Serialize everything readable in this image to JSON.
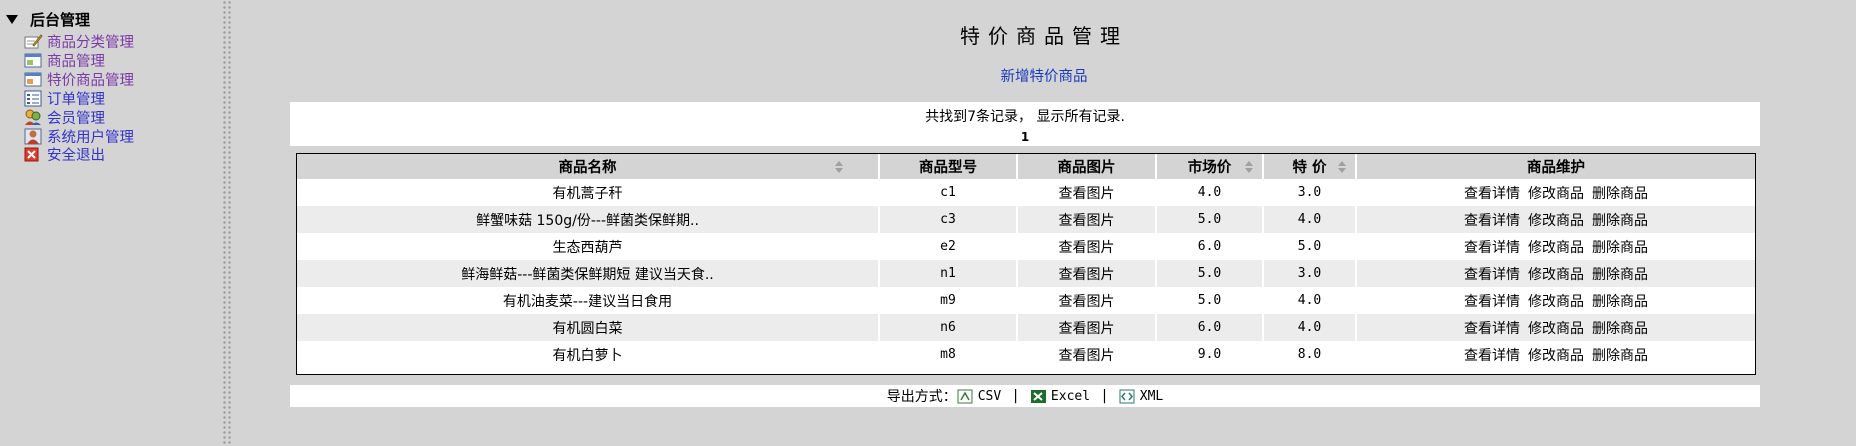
{
  "sidebar": {
    "root_label": "后台管理",
    "items": [
      {
        "label": "商品分类管理",
        "icon": "pencil-note-icon"
      },
      {
        "label": "商品管理",
        "icon": "window-icon"
      },
      {
        "label": "特价商品管理",
        "icon": "window-icon"
      },
      {
        "label": "订单管理",
        "icon": "list-icon"
      },
      {
        "label": "会员管理",
        "icon": "users-icon"
      },
      {
        "label": "系统用户管理",
        "icon": "user-icon"
      },
      {
        "label": "安全退出",
        "icon": "close-icon"
      }
    ]
  },
  "main": {
    "title": "特价商品管理",
    "add_link": "新增特价商品",
    "summary": "共找到7条记录， 显示所有记录.",
    "page_number": "1"
  },
  "table": {
    "headers": [
      "商品名称",
      "商品型号",
      "商品图片",
      "市场价",
      "特 价",
      "商品维护"
    ],
    "rows": [
      {
        "name": "有机蒿子秆",
        "model": "c1",
        "image": "查看图片",
        "market_price": "4.0",
        "special_price": "3.0"
      },
      {
        "name": "鲜蟹味菇 150g/份---鲜菌类保鲜期..",
        "model": "c3",
        "image": "查看图片",
        "market_price": "5.0",
        "special_price": "4.0"
      },
      {
        "name": "生态西葫芦",
        "model": "e2",
        "image": "查看图片",
        "market_price": "6.0",
        "special_price": "5.0"
      },
      {
        "name": "鲜海鲜菇---鲜菌类保鲜期短 建议当天食..",
        "model": "n1",
        "image": "查看图片",
        "market_price": "5.0",
        "special_price": "3.0"
      },
      {
        "name": "有机油麦菜---建议当日食用",
        "model": "m9",
        "image": "查看图片",
        "market_price": "5.0",
        "special_price": "4.0"
      },
      {
        "name": "有机圆白菜",
        "model": "n6",
        "image": "查看图片",
        "market_price": "6.0",
        "special_price": "4.0"
      },
      {
        "name": "有机白萝卜",
        "model": "m8",
        "image": "查看图片",
        "market_price": "9.0",
        "special_price": "8.0"
      }
    ],
    "actions": [
      "查看详情",
      "修改商品",
      "删除商品"
    ]
  },
  "export": {
    "label": "导出方式：",
    "csv": "CSV",
    "excel": "Excel",
    "xml": "XML",
    "sep": "|"
  }
}
